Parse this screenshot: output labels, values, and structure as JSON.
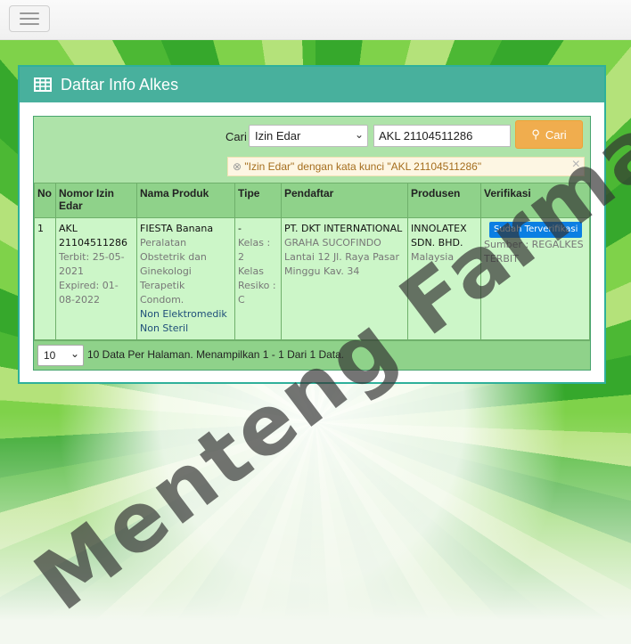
{
  "header": {
    "menu_icon": "hamburger-icon"
  },
  "panel": {
    "title": "Daftar Info Alkes",
    "icon": "table-icon"
  },
  "search": {
    "label": "Cari",
    "type_selected": "Izin Edar",
    "keyword": "AKL 21104511286",
    "button_label": "Cari",
    "alert_text": "\"Izin Edar\" dengan kata kunci \"AKL 21104511286\""
  },
  "table": {
    "columns": [
      "No",
      "Nomor Izin Edar",
      "Nama Produk",
      "Tipe",
      "Pendaftar",
      "Produsen",
      "Verifikasi"
    ],
    "rows": [
      {
        "no": "1",
        "nomor": "AKL 21104511286",
        "terbit": "Terbit: 25-05-2021",
        "expired": "Expired: 01-08-2022",
        "produk_nama": "FIESTA Banana",
        "produk_kategori": "Peralatan Obstetrik dan Ginekologi Terapetik Condom.",
        "produk_elektromedik": "Non Elektromedik",
        "produk_steril": "Non Steril",
        "tipe": "-",
        "kelas": "Kelas : 2",
        "kelas_resiko": "Kelas Resiko : C",
        "pendaftar_nama": "PT. DKT INTERNATIONAL",
        "pendaftar_alamat": "GRAHA SUCOFINDO Lantai 12 Jl. Raya Pasar Minggu Kav. 34",
        "produsen_nama": "INNOLATEX SDN. BHD.",
        "produsen_negara": "Malaysia",
        "verifikasi_badge": "Sudah Terverifikasi",
        "verifikasi_sumber": "Sumber : REGALKES TERBIT"
      }
    ]
  },
  "pagination": {
    "per_page": "10",
    "summary": "10 Data Per Halaman. Menampilkan 1 - 1 Dari 1 Data."
  },
  "watermark": "Menteng Farma",
  "colors": {
    "panel_header": "#48b09d",
    "table_bg": "#aee3a9",
    "row_bg": "#ccf6c8",
    "search_button": "#f0ad4e",
    "verified_badge": "#0b7fe3"
  }
}
